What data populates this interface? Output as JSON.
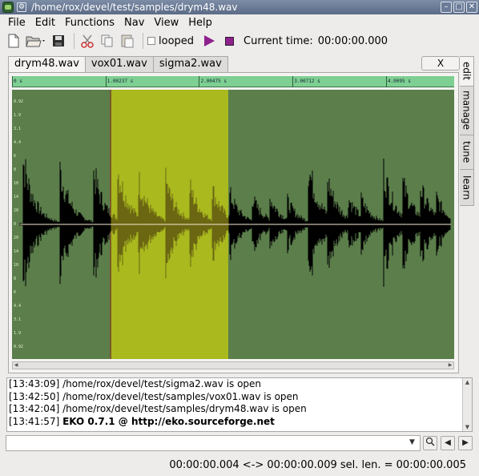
{
  "window": {
    "title": "/home/rox/devel/test/samples/drym48.wav"
  },
  "menu": [
    "File",
    "Edit",
    "Functions",
    "Nav",
    "View",
    "Help"
  ],
  "toolbar": {
    "looped_label": "looped",
    "looped_checked": false,
    "current_time_label": "Current time:",
    "current_time_value": "00:00:00.000"
  },
  "tabs": [
    "drym48.wav",
    "vox01.wav",
    "sigma2.wav"
  ],
  "active_tab": 0,
  "close_label": "X",
  "side_tabs": [
    "edit",
    "manage",
    "tune",
    "learn"
  ],
  "active_side_tab": 0,
  "ruler": {
    "ticks": [
      {
        "t": 0,
        "label": "0 s"
      },
      {
        "t": 1.00237,
        "label": "1.00237 s"
      },
      {
        "t": 2.00475,
        "label": "2.00475 s"
      },
      {
        "t": 3.00712,
        "label": "3.00712 s"
      },
      {
        "t": 4.0095,
        "label": "4.0095 s"
      }
    ],
    "t_max": 4.74
  },
  "waveform": {
    "selection_start_s": 1.06,
    "selection_end_s": 2.32,
    "amplitude_labels": [
      "0.92",
      "1.9",
      "3.1",
      "4.4",
      "6",
      "8",
      "10",
      "14",
      "20",
      "0",
      "20",
      "14",
      "10",
      "8",
      "6",
      "4.4",
      "3.1",
      "1.9",
      "0.92"
    ],
    "colors": {
      "background": "#5b7e4b",
      "selection": "#a9b91e",
      "wave": "#000000",
      "wave_in_selection": "#6b6612",
      "center_line": "#f4ead2"
    }
  },
  "log": {
    "lines": [
      "[13:43:09] /home/rox/devel/test/sigma2.wav is open",
      "[13:42:50] /home/rox/devel/test/samples/vox01.wav is open",
      "[13:42:04] /home/rox/devel/test/samples/drym48.wav is open"
    ],
    "last_time": "[13:41:57]",
    "last_bold": "EKO 0.7.1 @ http://eko.sourceforge.net"
  },
  "command": {
    "value": ""
  },
  "status": "00:00:00.004 <-> 00:00:00.009  sel. len. = 00:00:00.005"
}
